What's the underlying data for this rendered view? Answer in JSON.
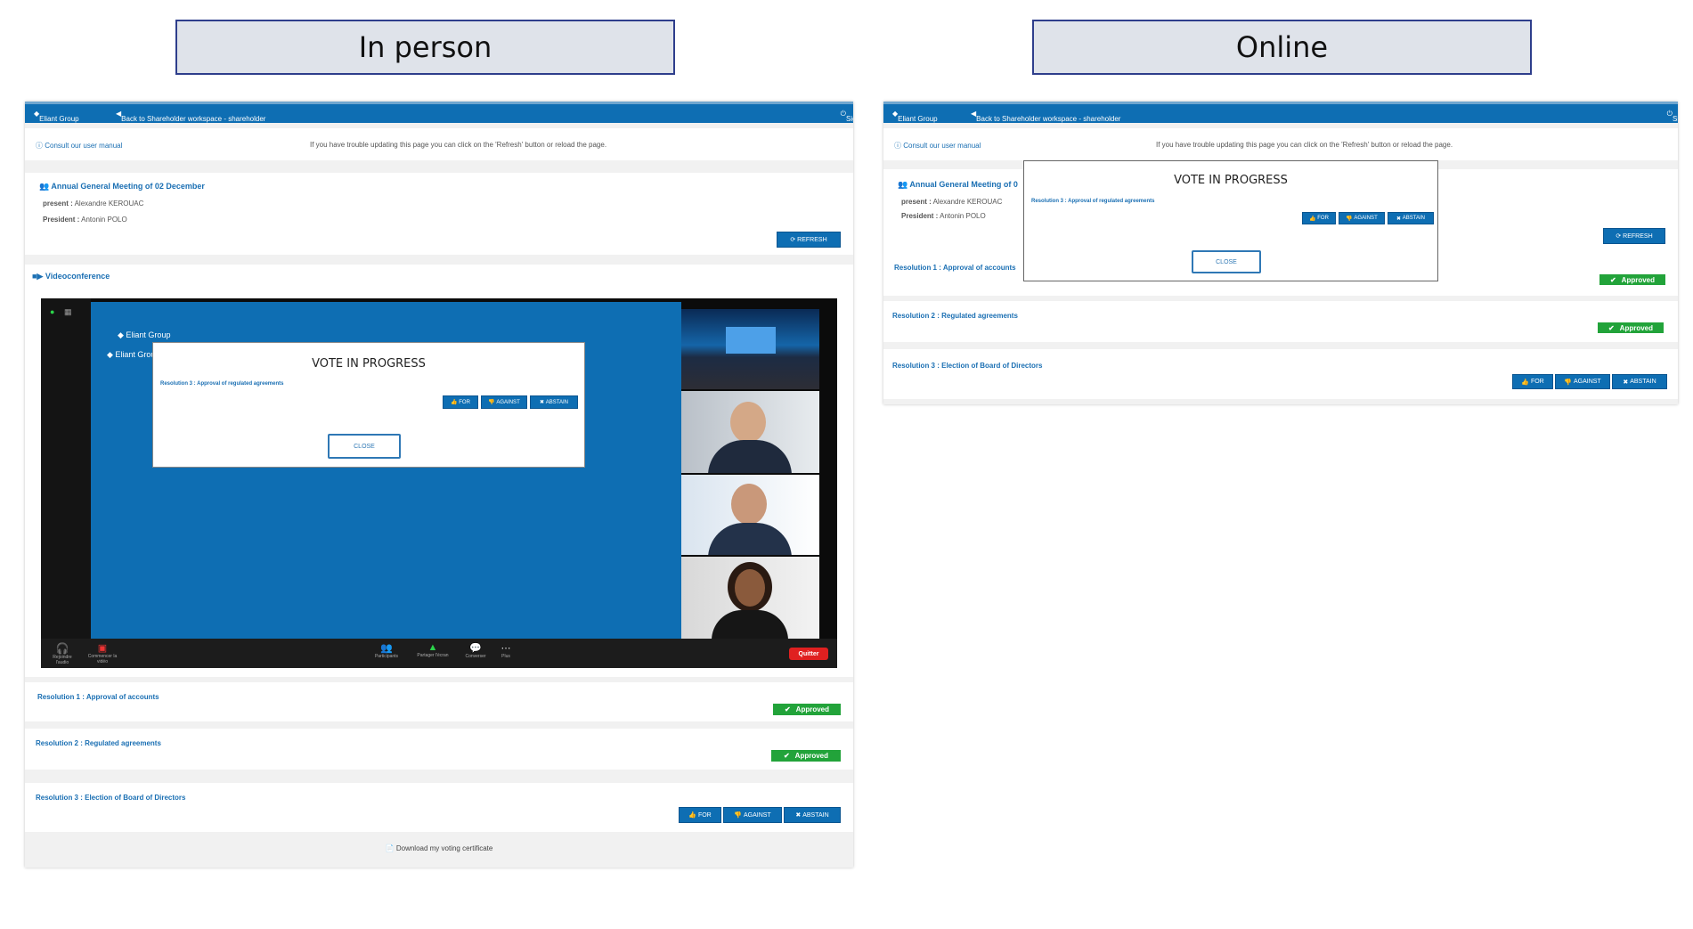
{
  "headings": {
    "left": "In person",
    "right": "Online"
  },
  "topbar": {
    "brand": "Eliant Group",
    "back": "Back to Shareholder workspace - shareholder",
    "signout": "Sign Out"
  },
  "manual": {
    "link": "Consult our user manual",
    "hint": "If you have trouble updating this page you can click on the 'Refresh' button or reload the page."
  },
  "meeting": {
    "title": "Annual General Meeting of 02 December",
    "title_truncated": "Annual General Meeting of 0",
    "present_label": "present :",
    "present_value": "Alexandre KEROUAC",
    "president_label": "President :",
    "president_value": "Antonin POLO",
    "refresh": "REFRESH"
  },
  "videoconference": {
    "title": "Videoconference",
    "shared_brand": "Eliant Group",
    "shared_brand_2": "Eliant Grou",
    "toolbar": {
      "audio": "Rejoindre l'audio",
      "video": "Commencer la vidéo",
      "participants": "Participants",
      "share": "Partager l'écran",
      "chat": "Converser",
      "more": "Plus",
      "quit": "Quitter"
    }
  },
  "vote_modal": {
    "title": "VOTE IN PROGRESS",
    "resolution": "Resolution 3 : Approval of regulated agreements",
    "for": "FOR",
    "against": "AGAINST",
    "abstain": "ABSTAIN",
    "close": "CLOSE"
  },
  "resolutions": [
    {
      "title": "Resolution 1 : Approval of accounts",
      "status": "Approved"
    },
    {
      "title": "Resolution 2 : Regulated agreements",
      "status": "Approved"
    },
    {
      "title": "Resolution 3 : Election of Board of Directors",
      "status": ""
    }
  ],
  "vote_buttons": {
    "for": "FOR",
    "against": "AGAINST",
    "abstain": "ABSTAIN"
  },
  "footer": {
    "download": "Download my voting certificate"
  },
  "colors": {
    "primary": "#0e6eb3",
    "approved": "#22a33a",
    "quit": "#e02020"
  }
}
